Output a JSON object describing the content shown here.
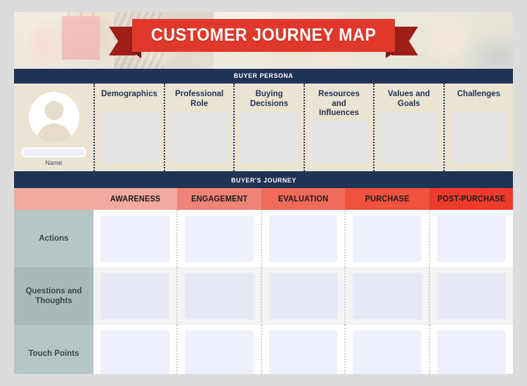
{
  "title": "CUSTOMER JOURNEY MAP",
  "persona": {
    "section_label": "BUYER PERSONA",
    "avatar_icon": "user-avatar-icon",
    "name_placeholder": "",
    "name_value": "",
    "name_label": "Name",
    "columns": [
      {
        "title": "Demographics",
        "value": ""
      },
      {
        "title": "Professional Role",
        "value": ""
      },
      {
        "title": "Buying Decisions",
        "value": ""
      },
      {
        "title": "Resources and Influences",
        "value": ""
      },
      {
        "title": "Values and Goals",
        "value": ""
      },
      {
        "title": "Challenges",
        "value": ""
      }
    ]
  },
  "journey": {
    "section_label": "BUYER'S JOURNEY",
    "stages": [
      {
        "label": "AWARENESS",
        "color": "#f2a99f"
      },
      {
        "label": "ENGAGEMENT",
        "color": "#ef8377"
      },
      {
        "label": "EVALUATION",
        "color": "#ef6a58"
      },
      {
        "label": "PURCHASE",
        "color": "#ef5340"
      },
      {
        "label": "POST-PURCHASE",
        "color": "#ef3b2c"
      }
    ],
    "rows": [
      {
        "label": "Actions",
        "cells": [
          "",
          "",
          "",
          "",
          ""
        ]
      },
      {
        "label": "Questions and Thoughts",
        "cells": [
          "",
          "",
          "",
          "",
          ""
        ]
      },
      {
        "label": "Touch Points",
        "cells": [
          "",
          "",
          "",
          "",
          ""
        ]
      }
    ]
  },
  "colors": {
    "navy": "#1f3355",
    "red": "#e0392b",
    "red_dark": "#9e1f18",
    "cream": "#ece4d3",
    "sage": "#b4c7c4",
    "cell": "#eef0fb",
    "page_bg": "#dcdcdc"
  }
}
